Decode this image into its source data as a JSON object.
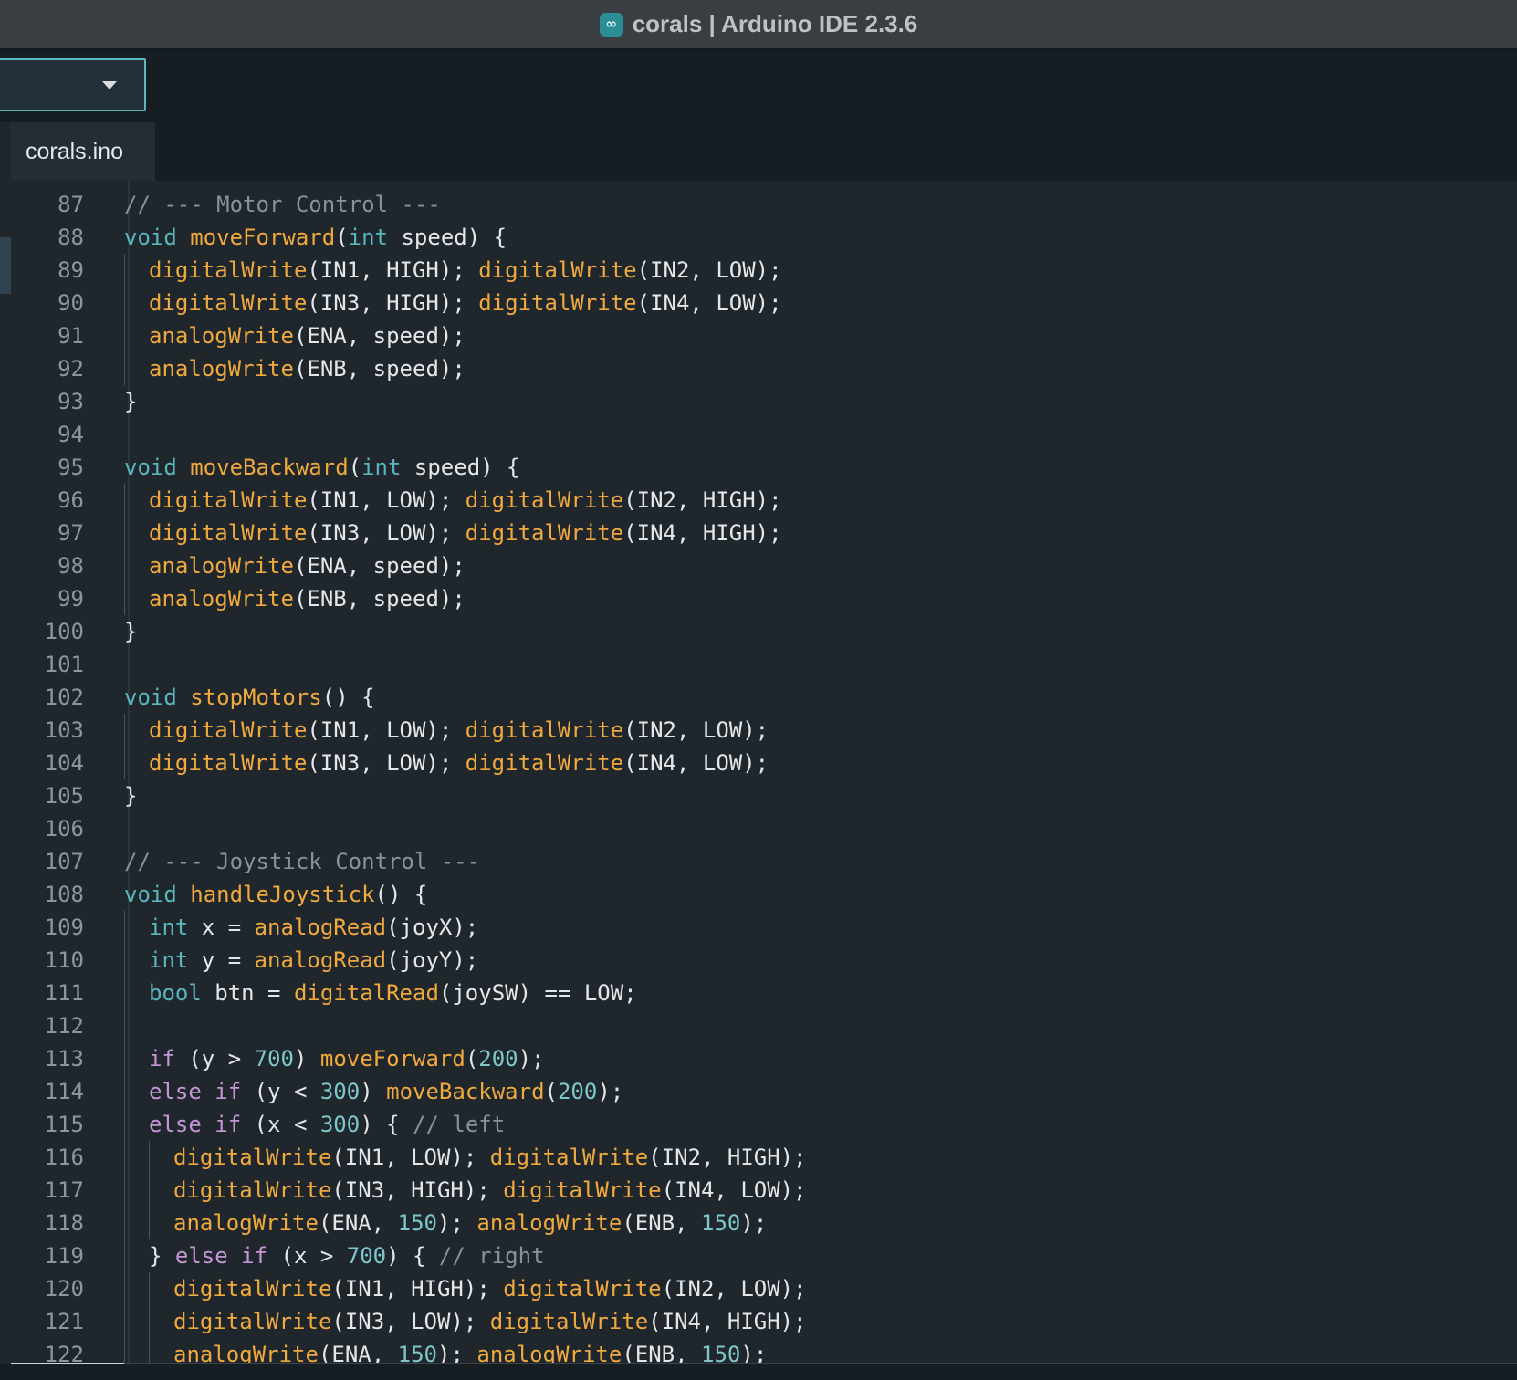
{
  "window": {
    "title": "corals | Arduino IDE 2.3.6",
    "icon": "arduino-infinity-icon",
    "icon_glyph": "∞"
  },
  "toolbar": {
    "board_selector_value": ""
  },
  "tabs": [
    {
      "label": "corals.ino"
    }
  ],
  "colors": {
    "keyword": "#59b6bc",
    "function": "#f0a93d",
    "control": "#c596d6",
    "number": "#7ec7cc",
    "comment": "#8a9298",
    "accent": "#5eb7bd"
  },
  "code_lines": [
    {
      "n": "87",
      "indent": 0,
      "tokens": [
        [
          "c",
          "// --- Motor Control ---"
        ]
      ]
    },
    {
      "n": "88",
      "indent": 0,
      "tokens": [
        [
          "k",
          "void"
        ],
        [
          "p",
          " "
        ],
        [
          "f",
          "moveForward"
        ],
        [
          "p",
          "("
        ],
        [
          "k",
          "int"
        ],
        [
          "p",
          " speed) {"
        ]
      ]
    },
    {
      "n": "89",
      "indent": 1,
      "tokens": [
        [
          "f",
          "digitalWrite"
        ],
        [
          "p",
          "(IN1, HIGH); "
        ],
        [
          "f",
          "digitalWrite"
        ],
        [
          "p",
          "(IN2, LOW);"
        ]
      ]
    },
    {
      "n": "90",
      "indent": 1,
      "tokens": [
        [
          "f",
          "digitalWrite"
        ],
        [
          "p",
          "(IN3, HIGH); "
        ],
        [
          "f",
          "digitalWrite"
        ],
        [
          "p",
          "(IN4, LOW);"
        ]
      ]
    },
    {
      "n": "91",
      "indent": 1,
      "tokens": [
        [
          "f",
          "analogWrite"
        ],
        [
          "p",
          "(ENA, speed);"
        ]
      ]
    },
    {
      "n": "92",
      "indent": 1,
      "tokens": [
        [
          "f",
          "analogWrite"
        ],
        [
          "p",
          "(ENB, speed);"
        ]
      ]
    },
    {
      "n": "93",
      "indent": 0,
      "tokens": [
        [
          "p",
          "}"
        ]
      ]
    },
    {
      "n": "94",
      "indent": 0,
      "tokens": []
    },
    {
      "n": "95",
      "indent": 0,
      "tokens": [
        [
          "k",
          "void"
        ],
        [
          "p",
          " "
        ],
        [
          "f",
          "moveBackward"
        ],
        [
          "p",
          "("
        ],
        [
          "k",
          "int"
        ],
        [
          "p",
          " speed) {"
        ]
      ]
    },
    {
      "n": "96",
      "indent": 1,
      "tokens": [
        [
          "f",
          "digitalWrite"
        ],
        [
          "p",
          "(IN1, LOW); "
        ],
        [
          "f",
          "digitalWrite"
        ],
        [
          "p",
          "(IN2, HIGH);"
        ]
      ]
    },
    {
      "n": "97",
      "indent": 1,
      "tokens": [
        [
          "f",
          "digitalWrite"
        ],
        [
          "p",
          "(IN3, LOW); "
        ],
        [
          "f",
          "digitalWrite"
        ],
        [
          "p",
          "(IN4, HIGH);"
        ]
      ]
    },
    {
      "n": "98",
      "indent": 1,
      "tokens": [
        [
          "f",
          "analogWrite"
        ],
        [
          "p",
          "(ENA, speed);"
        ]
      ]
    },
    {
      "n": "99",
      "indent": 1,
      "tokens": [
        [
          "f",
          "analogWrite"
        ],
        [
          "p",
          "(ENB, speed);"
        ]
      ]
    },
    {
      "n": "100",
      "indent": 0,
      "tokens": [
        [
          "p",
          "}"
        ]
      ]
    },
    {
      "n": "101",
      "indent": 0,
      "tokens": []
    },
    {
      "n": "102",
      "indent": 0,
      "tokens": [
        [
          "k",
          "void"
        ],
        [
          "p",
          " "
        ],
        [
          "f",
          "stopMotors"
        ],
        [
          "p",
          "() {"
        ]
      ]
    },
    {
      "n": "103",
      "indent": 1,
      "tokens": [
        [
          "f",
          "digitalWrite"
        ],
        [
          "p",
          "(IN1, LOW); "
        ],
        [
          "f",
          "digitalWrite"
        ],
        [
          "p",
          "(IN2, LOW);"
        ]
      ]
    },
    {
      "n": "104",
      "indent": 1,
      "tokens": [
        [
          "f",
          "digitalWrite"
        ],
        [
          "p",
          "(IN3, LOW); "
        ],
        [
          "f",
          "digitalWrite"
        ],
        [
          "p",
          "(IN4, LOW);"
        ]
      ]
    },
    {
      "n": "105",
      "indent": 0,
      "tokens": [
        [
          "p",
          "}"
        ]
      ]
    },
    {
      "n": "106",
      "indent": 0,
      "tokens": []
    },
    {
      "n": "107",
      "indent": 0,
      "tokens": [
        [
          "c",
          "// --- Joystick Control ---"
        ]
      ]
    },
    {
      "n": "108",
      "indent": 0,
      "tokens": [
        [
          "k",
          "void"
        ],
        [
          "p",
          " "
        ],
        [
          "f",
          "handleJoystick"
        ],
        [
          "p",
          "() {"
        ]
      ]
    },
    {
      "n": "109",
      "indent": 1,
      "tokens": [
        [
          "k",
          "int"
        ],
        [
          "p",
          " x = "
        ],
        [
          "f",
          "analogRead"
        ],
        [
          "p",
          "(joyX);"
        ]
      ]
    },
    {
      "n": "110",
      "indent": 1,
      "tokens": [
        [
          "k",
          "int"
        ],
        [
          "p",
          " y = "
        ],
        [
          "f",
          "analogRead"
        ],
        [
          "p",
          "(joyY);"
        ]
      ]
    },
    {
      "n": "111",
      "indent": 1,
      "tokens": [
        [
          "k",
          "bool"
        ],
        [
          "p",
          " btn = "
        ],
        [
          "f",
          "digitalRead"
        ],
        [
          "p",
          "(joySW) == LOW;"
        ]
      ]
    },
    {
      "n": "112",
      "indent": 1,
      "tokens": []
    },
    {
      "n": "113",
      "indent": 1,
      "tokens": [
        [
          "x",
          "if"
        ],
        [
          "p",
          " (y > "
        ],
        [
          "n",
          "700"
        ],
        [
          "p",
          ") "
        ],
        [
          "f",
          "moveForward"
        ],
        [
          "p",
          "("
        ],
        [
          "n",
          "200"
        ],
        [
          "p",
          ");"
        ]
      ]
    },
    {
      "n": "114",
      "indent": 1,
      "tokens": [
        [
          "x",
          "else if"
        ],
        [
          "p",
          " (y < "
        ],
        [
          "n",
          "300"
        ],
        [
          "p",
          ") "
        ],
        [
          "f",
          "moveBackward"
        ],
        [
          "p",
          "("
        ],
        [
          "n",
          "200"
        ],
        [
          "p",
          ");"
        ]
      ]
    },
    {
      "n": "115",
      "indent": 1,
      "tokens": [
        [
          "x",
          "else if"
        ],
        [
          "p",
          " (x < "
        ],
        [
          "n",
          "300"
        ],
        [
          "p",
          ") { "
        ],
        [
          "c",
          "// left"
        ]
      ]
    },
    {
      "n": "116",
      "indent": 2,
      "tokens": [
        [
          "f",
          "digitalWrite"
        ],
        [
          "p",
          "(IN1, LOW); "
        ],
        [
          "f",
          "digitalWrite"
        ],
        [
          "p",
          "(IN2, HIGH);"
        ]
      ]
    },
    {
      "n": "117",
      "indent": 2,
      "tokens": [
        [
          "f",
          "digitalWrite"
        ],
        [
          "p",
          "(IN3, HIGH); "
        ],
        [
          "f",
          "digitalWrite"
        ],
        [
          "p",
          "(IN4, LOW);"
        ]
      ]
    },
    {
      "n": "118",
      "indent": 2,
      "tokens": [
        [
          "f",
          "analogWrite"
        ],
        [
          "p",
          "(ENA, "
        ],
        [
          "n",
          "150"
        ],
        [
          "p",
          "); "
        ],
        [
          "f",
          "analogWrite"
        ],
        [
          "p",
          "(ENB, "
        ],
        [
          "n",
          "150"
        ],
        [
          "p",
          ");"
        ]
      ]
    },
    {
      "n": "119",
      "indent": 1,
      "tokens": [
        [
          "p",
          "} "
        ],
        [
          "x",
          "else if"
        ],
        [
          "p",
          " (x > "
        ],
        [
          "n",
          "700"
        ],
        [
          "p",
          ") { "
        ],
        [
          "c",
          "// right"
        ]
      ]
    },
    {
      "n": "120",
      "indent": 2,
      "tokens": [
        [
          "f",
          "digitalWrite"
        ],
        [
          "p",
          "(IN1, HIGH); "
        ],
        [
          "f",
          "digitalWrite"
        ],
        [
          "p",
          "(IN2, LOW);"
        ]
      ]
    },
    {
      "n": "121",
      "indent": 2,
      "tokens": [
        [
          "f",
          "digitalWrite"
        ],
        [
          "p",
          "(IN3, LOW); "
        ],
        [
          "f",
          "digitalWrite"
        ],
        [
          "p",
          "(IN4, HIGH);"
        ]
      ]
    },
    {
      "n": "122",
      "indent": 2,
      "tokens": [
        [
          "f",
          "analogWrite"
        ],
        [
          "p",
          "(ENA, "
        ],
        [
          "n",
          "150"
        ],
        [
          "p",
          "); "
        ],
        [
          "f",
          "analogWrite"
        ],
        [
          "p",
          "(ENB, "
        ],
        [
          "n",
          "150"
        ],
        [
          "p",
          ");"
        ]
      ]
    }
  ]
}
